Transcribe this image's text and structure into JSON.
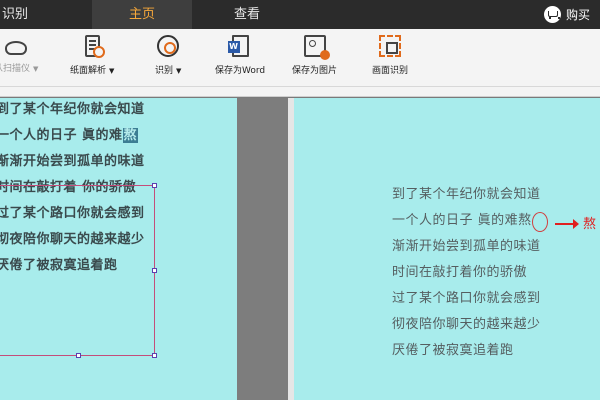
{
  "menubar": {
    "tabs": [
      {
        "label": "识别"
      },
      {
        "label": "主页"
      },
      {
        "label": "查看"
      }
    ],
    "buy_label": "购买"
  },
  "toolbar": {
    "items": [
      {
        "label": "从扫描仪",
        "icon": "scanner-icon"
      },
      {
        "label": "纸面解析",
        "icon": "document-analysis-icon"
      },
      {
        "label": "识别",
        "icon": "ocr-icon"
      },
      {
        "label": "保存为Word",
        "icon": "save-word-icon"
      },
      {
        "label": "保存为图片",
        "icon": "save-image-icon"
      },
      {
        "label": "画面识别",
        "icon": "screen-capture-icon"
      }
    ]
  },
  "left_pane": {
    "lines": [
      "到了某个年纪你就会知道",
      "一个人的日子 眞的难",
      "渐渐开始尝到孤单的味道",
      "时间在敲打着 你的骄傲",
      "过了某个路口你就会感到",
      "彻夜陪你聊天的越来越少",
      "厌倦了被寂寞追着跑"
    ],
    "highlight_char": "熬"
  },
  "right_pane": {
    "lines": [
      "到了某个年纪你就会知道",
      "一个人的日子 眞的难熬",
      "渐渐开始尝到孤单的味道",
      "时间在敲打着你的骄傲",
      "过了某个路口你就会感到",
      "彻夜陪你聊天的越来越少",
      "厌倦了被寂寞追着跑"
    ],
    "correction": "熬"
  }
}
